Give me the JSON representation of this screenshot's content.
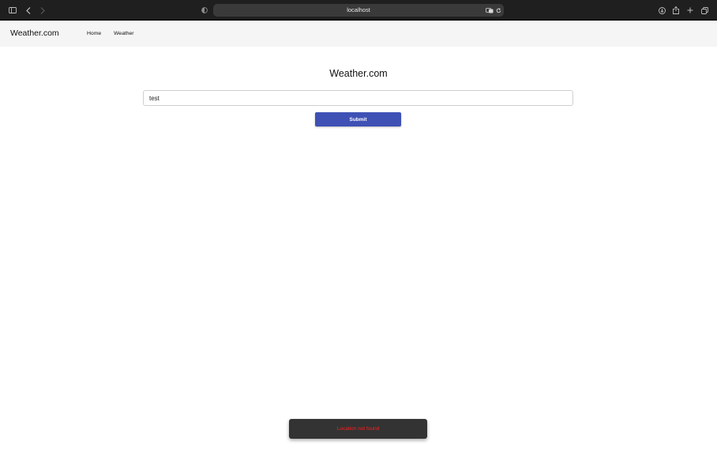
{
  "browser": {
    "url": "localhost",
    "icons": [
      "sidebar-icon",
      "back-icon",
      "forward-icon",
      "privacy-shield-icon",
      "translate-icon",
      "reload-icon",
      "download-icon",
      "share-icon",
      "new-tab-icon",
      "tab-overview-icon"
    ]
  },
  "navbar": {
    "brand": "Weather.com",
    "links": [
      {
        "label": "Home"
      },
      {
        "label": "Weather"
      }
    ]
  },
  "main": {
    "title": "Weather.com",
    "search": {
      "value": "test",
      "placeholder": ""
    },
    "submit_label": "Submit"
  },
  "snackbar": {
    "message": "Location not found",
    "text_color": "#ff1f1f",
    "background": "#333333"
  },
  "colors": {
    "accent": "#3f51b5",
    "navbar_bg": "#f5f5f5",
    "browser_chrome": "#1f1f1f"
  }
}
